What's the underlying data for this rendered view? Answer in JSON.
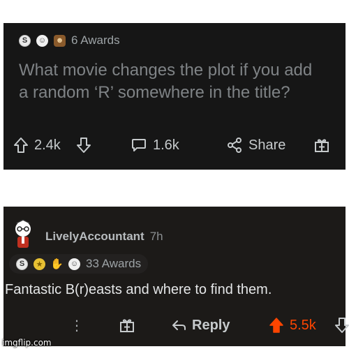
{
  "post": {
    "awards_count": "6 Awards",
    "award_icons": [
      "silver-award-icon",
      "helpful-award-icon",
      "brown-award-icon"
    ],
    "title": "What movie changes the plot if you add a random ‘R’ somewhere in the title?",
    "upvotes": "2.4k",
    "comments": "1.6k",
    "share_label": "Share"
  },
  "comment": {
    "username": "LivelyAccountant",
    "timestamp": "7h",
    "awards_count": "33 Awards",
    "award_icons": [
      "silver-award-icon",
      "gold-award-icon",
      "hands-award-icon",
      "helpful-award-icon"
    ],
    "text": "Fantastic B(r)easts and where to find them.",
    "reply_label": "Reply",
    "upvotes": "5.5k",
    "more_label": "⋮"
  },
  "watermark": "imgflip.com",
  "colors": {
    "background": "#161616",
    "muted_text": "#7f8386",
    "upvote_active": "#ff4500"
  }
}
